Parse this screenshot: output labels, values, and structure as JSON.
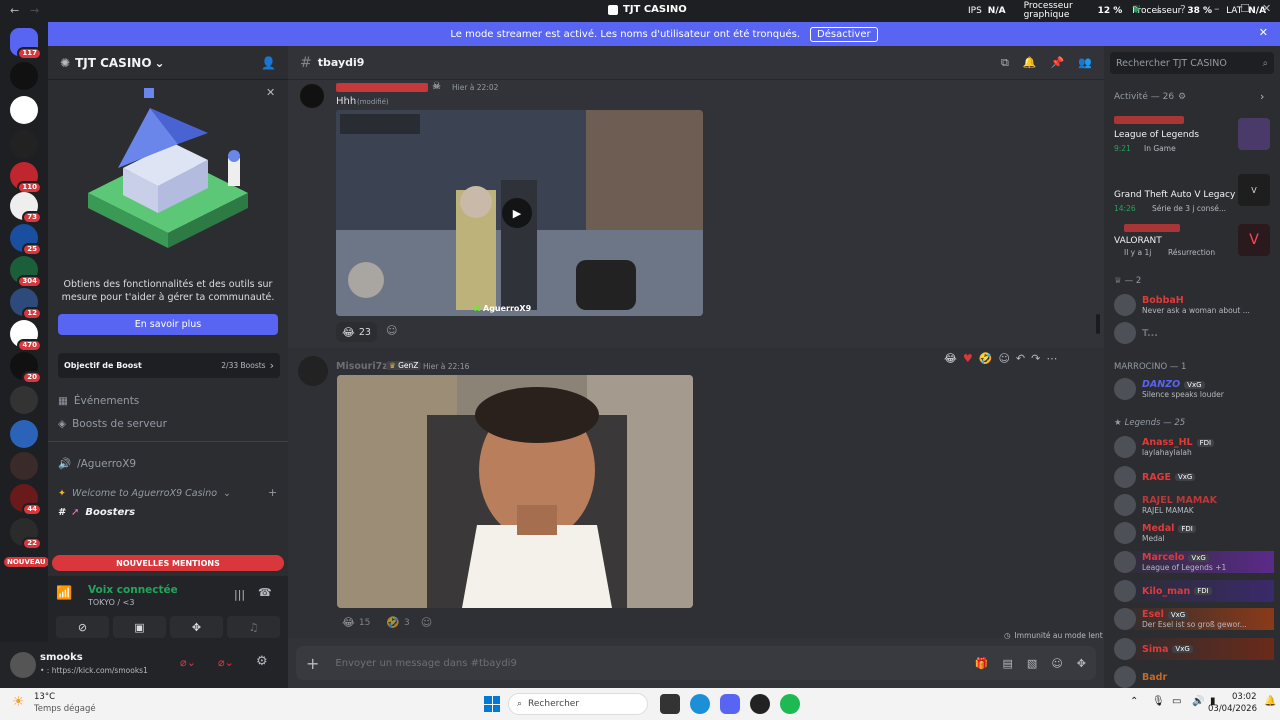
{
  "window": {
    "title": "TJT CASINO"
  },
  "hw": {
    "ips_label": "IPS",
    "ips_value": "N/A",
    "gpu_label": "Processeur graphique",
    "gpu_value": "12 %",
    "cpu_label": "Processeur",
    "cpu_value": "38 %",
    "lat_label": "LAT",
    "lat_value": "N/A"
  },
  "banner": {
    "text": "Le mode streamer est activé. Les noms d'utilisateur ont été tronqués.",
    "button": "Désactiver"
  },
  "guilds": {
    "badges": [
      "117",
      "110",
      "73",
      "25",
      "304",
      "12",
      "470",
      "20",
      "44",
      "22"
    ],
    "new_label": "NOUVEAU"
  },
  "server": {
    "name": "TJT CASINO",
    "promo": "Obtiens des fonctionnalités et des outils sur mesure pour t'aider à gérer ta communauté.",
    "promo_button": "En savoir plus",
    "boost_goal": "Objectif de Boost",
    "boost_count": "2/33 Boosts",
    "events": "Événements",
    "server_boosts": "Boosts de serveur",
    "voice_channel": "/AguerroX9",
    "category": "Welcome to AguerroX9 Casino",
    "boosters": "Boosters",
    "new_mentions": "NOUVELLES MENTIONS"
  },
  "voice": {
    "status": "Voix connectée",
    "channel": "TOKYO / <3"
  },
  "user": {
    "name": "smooks",
    "status": "• : https://kick.com/smooks1"
  },
  "chat": {
    "channel": "tbaydi9",
    "messages": [
      {
        "time": "Hier à 22:02",
        "text": "Hhh",
        "edited": "(modifié)",
        "video_tag": "AguerroX9",
        "reactions": [
          {
            "emoji": "😂",
            "count": "23"
          }
        ]
      },
      {
        "author": "Misouri7z",
        "badge": "GenZ",
        "time": "Hier à 22:16",
        "reactions": [
          {
            "count": "15"
          },
          {
            "count": "3"
          }
        ]
      }
    ],
    "slowmode": "Immunité au mode lent",
    "placeholder": "Envoyer un message dans #tbaydi9"
  },
  "search": {
    "placeholder": "Rechercher TJT CASINO"
  },
  "activity": {
    "header": "Activité — 26",
    "items": [
      {
        "game": "League of Legends",
        "time": "9:21",
        "detail": "In Game"
      },
      {
        "game": "Grand Theft Auto V Legacy",
        "time": "14:26",
        "detail": "Série de 3 j consé..."
      },
      {
        "game": "VALORANT",
        "time": "Il y a 1j",
        "detail": "Résurrection"
      }
    ]
  },
  "member_groups": [
    {
      "label": "— 2",
      "members": [
        {
          "name": "BobbaH",
          "sub": "Never ask a woman about ..."
        },
        {
          "name": "T...",
          "sub": ""
        }
      ]
    },
    {
      "label": "MARROCINO — 1",
      "members": [
        {
          "name": "DANZO",
          "tag": "VxG",
          "sub": "Silence speaks louder"
        }
      ]
    },
    {
      "label": "Legends — 25",
      "members": [
        {
          "name": "Anass_HL",
          "tag": "FDI",
          "sub": "laylahaylalah"
        },
        {
          "name": "RAGE",
          "tag": "VxG",
          "sub": ""
        },
        {
          "name": "RAJEL MAMAK",
          "tag": "",
          "sub": "RAJEL MAMAK"
        },
        {
          "name": "Medal",
          "tag": "FDI",
          "sub": "Medal"
        },
        {
          "name": "Marcelo",
          "tag": "VxG",
          "sub": "League of Legends +1"
        },
        {
          "name": "Kilo_man",
          "tag": "FDI",
          "sub": ""
        },
        {
          "name": "Esel",
          "tag": "VxG",
          "sub": "Der Esel ist so groß gewor..."
        },
        {
          "name": "Sima",
          "tag": "VxG",
          "sub": ""
        },
        {
          "name": "Badr",
          "tag": "",
          "sub": ""
        }
      ]
    }
  ],
  "taskbar": {
    "temp": "13°C",
    "weather": "Temps dégagé",
    "search": "Rechercher",
    "time": "03:02",
    "date": "03/04/2026"
  },
  "colors": {
    "accent": "#5865f2",
    "danger": "#da373c",
    "online": "#23a55a"
  }
}
